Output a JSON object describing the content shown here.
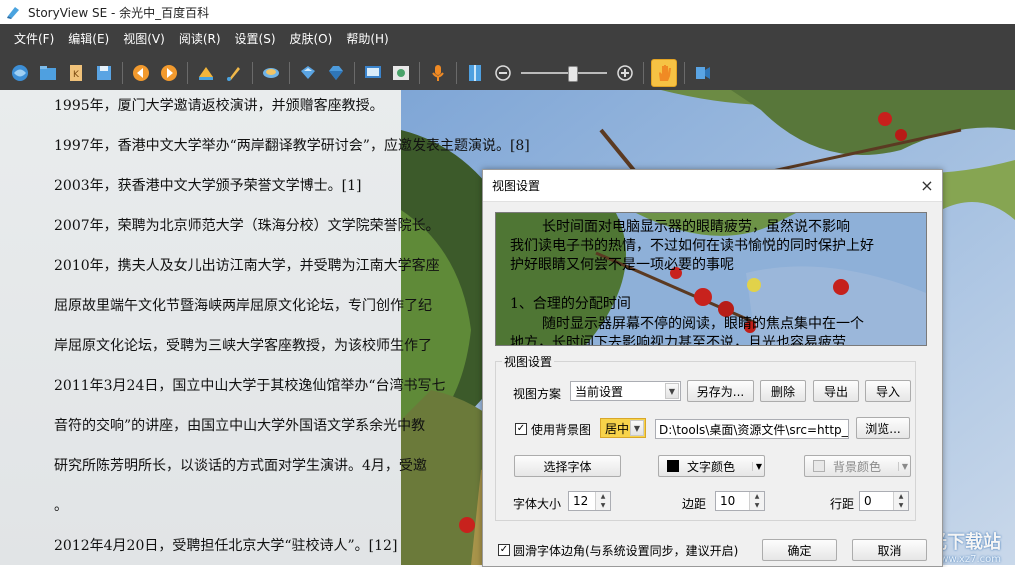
{
  "window": {
    "title": "StoryView SE - 余光中_百度百科"
  },
  "menu": [
    "文件(F)",
    "编辑(E)",
    "视图(V)",
    "阅读(R)",
    "设置(S)",
    "皮肤(O)",
    "帮助(H)"
  ],
  "toolbar": {
    "zoom_level_fraction": 0.62,
    "icons": [
      "open-folder-icon",
      "bookmark-icon",
      "save-icon",
      "prev-icon",
      "next-icon",
      "color-icon",
      "brush-icon",
      "mirror-icon",
      "paint-icon",
      "gem-icon",
      "screen-icon",
      "image-frame-icon",
      "mic-icon",
      "column-icon",
      "zoom-out-icon",
      "zoom-in-icon",
      "hand-icon",
      "read-aloud-icon"
    ]
  },
  "content": {
    "lines": [
      "1995年，厦门大学邀请返校演讲，并颁赠客座教授。",
      "1997年，香港中文大学举办“两岸翻译教学研讨会”，应邀发表主题演说。[8]",
      "2003年，获香港中文大学颁予荣誉文学博士。[1]",
      "2007年，荣聘为北京师范大学（珠海分校）文学院荣誉院长。",
      "2010年，携夫人及女儿出访江南大学，并受聘为江南大学客座",
      "屈原故里端午文化节暨海峡两岸屈原文化论坛，专门创作了纪",
      "岸屈原文化论坛，受聘为三峡大学客座教授，为该校师生作了",
      "2011年3月24日，国立中山大学于其校逸仙馆举办“台湾书写七",
      "音符的交响”的讲座，由国立中山大学外国语文学系余光中教",
      "研究所陈芳明所长，以谈话的方式面对学生演讲。4月，受邀",
      "。",
      "2012年4月20日，受聘担任北京大学“驻校诗人”。[12]"
    ]
  },
  "dialog": {
    "title": "视图设置",
    "close": "×",
    "preview": {
      "lines": [
        "长时间面对电脑显示器的眼睛疲劳，虽然说不影响",
        "我们读电子书的热情，不过如何在读书愉悦的同时保护上好",
        "护好眼睛又何尝不是一项必要的事呢",
        "1、合理的分配时间",
        "随时显示器屏幕不停的阅读，眼睛的焦点集中在一个",
        "地方，长时间下去影响视力甚至不说，且光也容易疲劳"
      ]
    },
    "group_label": "视图设置",
    "scheme_label": "视图方案",
    "scheme_value": "当前设置",
    "save_as": "另存为...",
    "delete": "删除",
    "export": "导出",
    "import": "导入",
    "use_bg_label": "使用背景图",
    "use_bg_checked": "✓",
    "bg_align": "居中",
    "bg_path": "D:\\tools\\桌面\\资源文件\\src=http___ir",
    "browse": "浏览...",
    "select_font": "选择字体",
    "text_color": "文字颜色",
    "text_color_hex": "#000000",
    "bg_color": "背景颜色",
    "font_size_label": "字体大小",
    "font_size": "12",
    "margin_label": "边距",
    "margin": "10",
    "line_spacing_label": "行距",
    "line_spacing": "0",
    "smooth_label": "圆滑字体边角(与系统设置同步，建议开启)",
    "smooth_checked": "✓",
    "ok": "确定",
    "cancel": "取消"
  },
  "watermark": {
    "name": "极光下载站",
    "url": "www.xz7.com"
  }
}
